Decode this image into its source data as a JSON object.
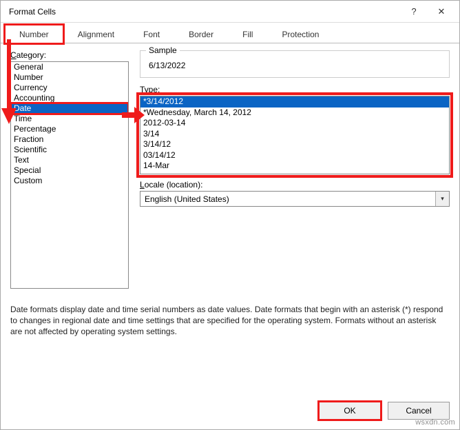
{
  "title": "Format Cells",
  "help_symbol": "?",
  "close_symbol": "✕",
  "tabs": [
    "Number",
    "Alignment",
    "Font",
    "Border",
    "Fill",
    "Protection"
  ],
  "active_tab_index": 0,
  "category_label": "Category:",
  "categories": [
    "General",
    "Number",
    "Currency",
    "Accounting",
    "Date",
    "Time",
    "Percentage",
    "Fraction",
    "Scientific",
    "Text",
    "Special",
    "Custom"
  ],
  "selected_category_index": 4,
  "sample": {
    "label": "Sample",
    "value": "6/13/2022"
  },
  "type_label": "Type:",
  "types": [
    "*3/14/2012",
    "*Wednesday, March 14, 2012",
    "2012-03-14",
    "3/14",
    "3/14/12",
    "03/14/12",
    "14-Mar"
  ],
  "selected_type_index": 0,
  "locale": {
    "label": "Locale (location):",
    "value": "English (United States)"
  },
  "description": "Date formats display date and time serial numbers as date values.  Date formats that begin with an asterisk (*) respond to changes in regional date and time settings that are specified for the operating system.  Formats without an asterisk are not affected by operating system settings.",
  "buttons": {
    "ok": "OK",
    "cancel": "Cancel"
  },
  "watermark": "wsxdn.com"
}
